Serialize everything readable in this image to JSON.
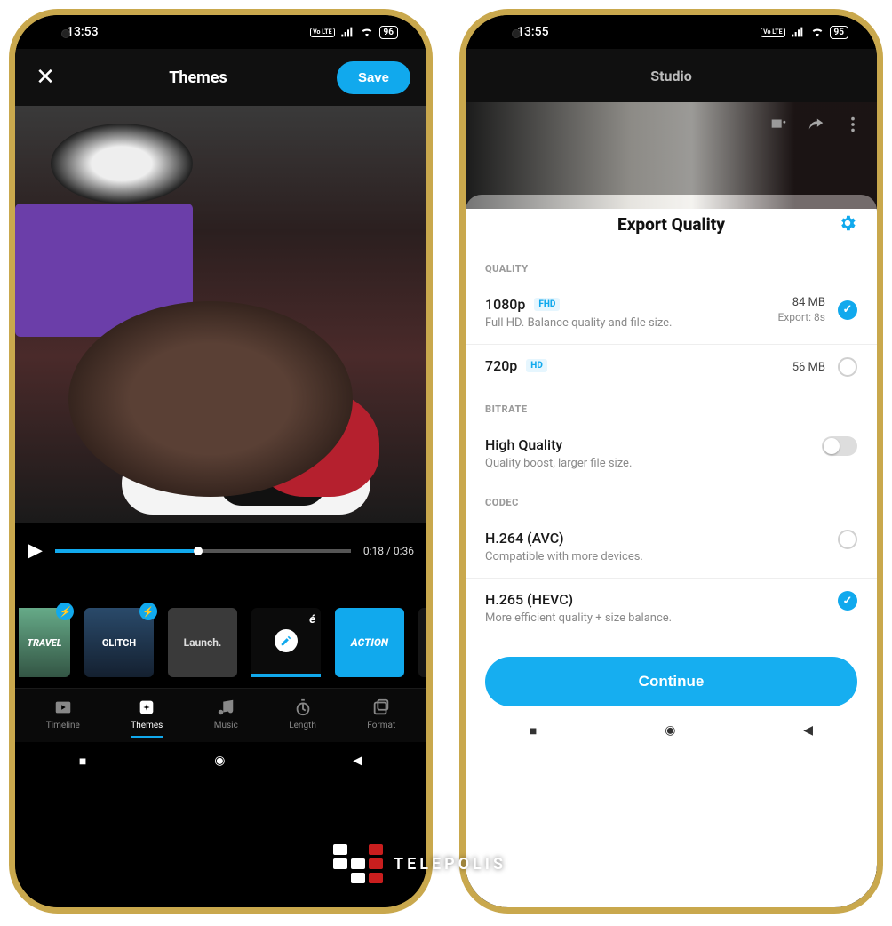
{
  "left": {
    "status": {
      "time": "13:53",
      "net": "Vo LTE",
      "battery": "96"
    },
    "header": {
      "title": "Themes",
      "save": "Save"
    },
    "player": {
      "time": "0:18 / 0:36"
    },
    "themes": [
      {
        "name": "TRAVEL",
        "bolt": true
      },
      {
        "name": "GLITCH",
        "bolt": true
      },
      {
        "name": "Launch."
      },
      {
        "name": "café",
        "selected": true
      },
      {
        "name": "ACTION"
      }
    ],
    "tabs": {
      "timeline": "Timeline",
      "themes": "Themes",
      "music": "Music",
      "length": "Length",
      "format": "Format"
    }
  },
  "right": {
    "status": {
      "time": "13:55",
      "net": "Vo LTE",
      "battery": "95"
    },
    "header": {
      "title": "Studio"
    },
    "sheet": {
      "title": "Export Quality",
      "sections": {
        "quality": {
          "label": "QUALITY",
          "options": [
            {
              "title": "1080p",
              "badge": "FHD",
              "sub": "Full HD. Balance quality and file size.",
              "size": "84 MB",
              "export": "Export: 8s",
              "selected": true
            },
            {
              "title": "720p",
              "badge": "HD",
              "sub": "",
              "size": "56 MB",
              "selected": false
            }
          ]
        },
        "bitrate": {
          "label": "BITRATE",
          "option": {
            "title": "High Quality",
            "sub": "Quality boost, larger file size.",
            "on": false
          }
        },
        "codec": {
          "label": "CODEC",
          "options": [
            {
              "title": "H.264 (AVC)",
              "sub": "Compatible with more devices.",
              "selected": false
            },
            {
              "title": "H.265 (HEVC)",
              "sub": "More efficient quality + size balance.",
              "selected": true
            }
          ]
        }
      },
      "continue": "Continue"
    }
  },
  "watermark": "TELEPOLIS"
}
